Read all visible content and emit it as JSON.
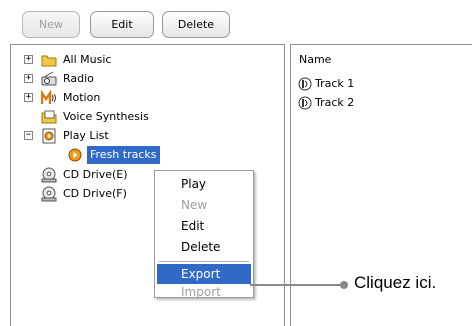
{
  "toolbar": {
    "new_label": "New",
    "edit_label": "Edit",
    "delete_label": "Delete"
  },
  "tree": {
    "items": [
      {
        "label": "All Music",
        "icon": "folder-icon",
        "expander": "+"
      },
      {
        "label": "Radio",
        "icon": "radio-icon",
        "expander": "+"
      },
      {
        "label": "Motion",
        "icon": "motion-icon",
        "expander": "+"
      },
      {
        "label": "Voice Synthesis",
        "icon": "voice-synthesis-icon",
        "expander": ""
      },
      {
        "label": "Play List",
        "icon": "playlist-icon",
        "expander": "−"
      },
      {
        "label": "Fresh tracks",
        "icon": "playlist-item-icon",
        "expander": ""
      },
      {
        "label": "CD Drive(E)",
        "icon": "cd-drive-icon",
        "expander": ""
      },
      {
        "label": "CD Drive(F)",
        "icon": "cd-drive-icon",
        "expander": ""
      }
    ]
  },
  "list": {
    "header": "Name",
    "rows": [
      "Track 1",
      "Track 2"
    ]
  },
  "context_menu": {
    "items": [
      {
        "label": "Play",
        "enabled": true
      },
      {
        "label": "New",
        "enabled": false
      },
      {
        "label": "Edit",
        "enabled": true
      },
      {
        "label": "Delete",
        "enabled": true
      },
      {
        "label": "Export",
        "enabled": true,
        "highlighted": true
      },
      {
        "label": "Import",
        "enabled": false
      }
    ]
  },
  "callout": {
    "text": "Cliquez ici."
  },
  "colors": {
    "selection": "#3169c6",
    "disabled_text": "#a0a0a0",
    "folder": "#f2c744"
  }
}
